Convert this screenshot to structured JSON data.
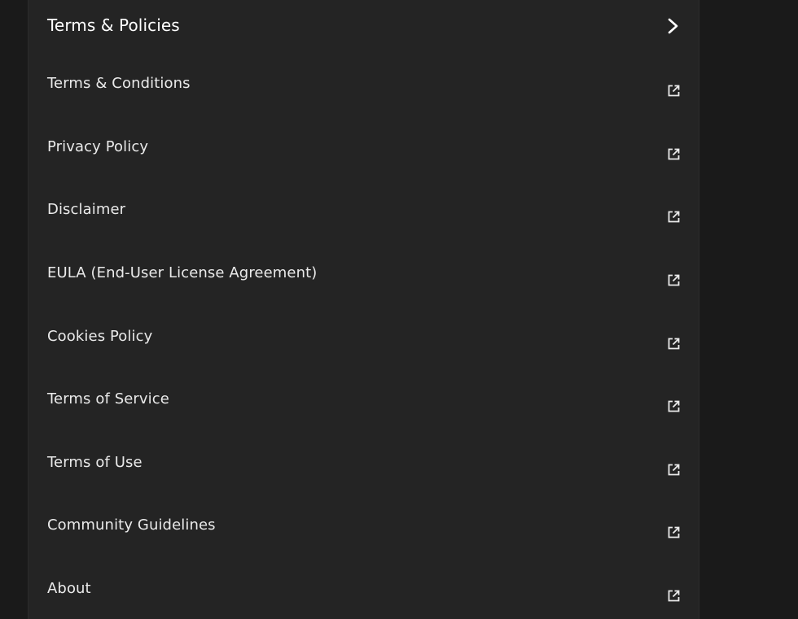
{
  "header": {
    "title": "Terms & Policies",
    "action_icon": "chevron-right-icon"
  },
  "items": [
    {
      "label": "Terms & Conditions",
      "icon": "external-link-icon"
    },
    {
      "label": "Privacy Policy",
      "icon": "external-link-icon"
    },
    {
      "label": "Disclaimer",
      "icon": "external-link-icon"
    },
    {
      "label": "EULA (End-User License Agreement)",
      "icon": "external-link-icon"
    },
    {
      "label": "Cookies Policy",
      "icon": "external-link-icon"
    },
    {
      "label": "Terms of Service",
      "icon": "external-link-icon"
    },
    {
      "label": "Terms of Use",
      "icon": "external-link-icon"
    },
    {
      "label": "Community Guidelines",
      "icon": "external-link-icon"
    },
    {
      "label": "About",
      "icon": "external-link-icon"
    }
  ],
  "colors": {
    "background": "#1a1a1a",
    "panel": "#242424",
    "text": "#eaeaea",
    "title": "#ffffff"
  }
}
